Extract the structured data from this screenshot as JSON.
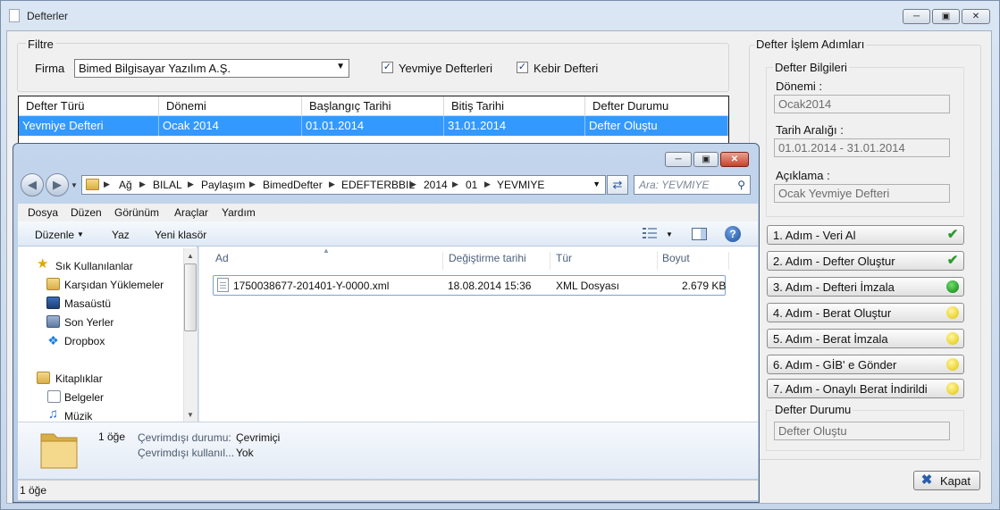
{
  "main_window": {
    "title": "Defterler",
    "filter": {
      "group_title": "Filtre",
      "firma_label": "Firma",
      "firma_value": "Bimed Bilgisayar Yazılım A.Ş.",
      "yevmiye_label": "Yevmiye Defterleri",
      "kebir_label": "Kebir Defteri",
      "yevmiye_checked": true,
      "kebir_checked": true
    },
    "grid": {
      "columns": [
        "Defter Türü",
        "Dönemi",
        "Başlangıç Tarihi",
        "Bitiş Tarihi",
        "Defter Durumu"
      ],
      "rows": [
        [
          "Yevmiye Defteri",
          "Ocak 2014",
          "01.01.2014",
          "31.01.2014",
          "Defter Oluştu"
        ]
      ]
    },
    "steps_panel": {
      "title": "Defter İşlem Adımları",
      "info_title": "Defter Bilgileri",
      "donemi_label": "Dönemi :",
      "donemi_value": "Ocak2014",
      "tarih_label": "Tarih Aralığı :",
      "tarih_value": "01.01.2014 - 31.01.2014",
      "aciklama_label": "Açıklama :",
      "aciklama_value": "Ocak Yevmiye Defteri",
      "steps": [
        {
          "label": "1. Adım - Veri Al",
          "status": "check-icon"
        },
        {
          "label": "2. Adım - Defter Oluştur",
          "status": "check-icon"
        },
        {
          "label": "3. Adım - Defteri İmzala",
          "status": "green-dot-icon"
        },
        {
          "label": "4. Adım - Berat Oluştur",
          "status": "yellow-dot-icon"
        },
        {
          "label": "5. Adım - Berat İmzala",
          "status": "yellow-dot-icon"
        },
        {
          "label": "6. Adım - GİB' e Gönder",
          "status": "yellow-dot-icon"
        },
        {
          "label": "7. Adım - Onaylı Berat İndirildi",
          "status": "yellow-dot-icon"
        }
      ],
      "durum_title": "Defter Durumu",
      "durum_value": "Defter Oluştu"
    },
    "close_button": "Kapat"
  },
  "explorer": {
    "address": [
      "Ağ",
      "BILAL",
      "Paylaşım",
      "BimedDefter",
      "EDEFTERBBIL",
      "2014",
      "01",
      "YEVMIYE"
    ],
    "search_placeholder": "Ara: YEVMIYE",
    "menu": [
      "Dosya",
      "Düzen",
      "Görünüm",
      "Araçlar",
      "Yardım"
    ],
    "toolbar": {
      "organize": "Düzenle",
      "print": "Yaz",
      "new_folder": "Yeni klasör"
    },
    "nav": {
      "favorites": "Sık Kullanılanlar",
      "downloads": "Karşıdan Yüklemeler",
      "desktop": "Masaüstü",
      "recent": "Son Yerler",
      "dropbox": "Dropbox",
      "libraries": "Kitaplıklar",
      "documents": "Belgeler",
      "music": "Müzik"
    },
    "columns": {
      "name": "Ad",
      "modified": "Değiştirme tarihi",
      "type": "Tür",
      "size": "Boyut"
    },
    "files": [
      {
        "name": "1750038677-201401-Y-0000.xml",
        "modified": "18.08.2014 15:36",
        "type": "XML Dosyası",
        "size": "2.679 KB"
      }
    ],
    "details": {
      "count": "1 öğe",
      "offline_status_label": "Çevrimdışı durumu:",
      "offline_status_value": "Çevrimiçi",
      "offline_avail_label": "Çevrimdışı kullanıl...",
      "offline_avail_value": "Yok"
    },
    "status": "1 öğe"
  },
  "colors": {
    "selection": "#3399ff",
    "check": "#2d9a2d",
    "green_dot": "#0a7d0a",
    "yellow_dot": "#e0c400"
  }
}
